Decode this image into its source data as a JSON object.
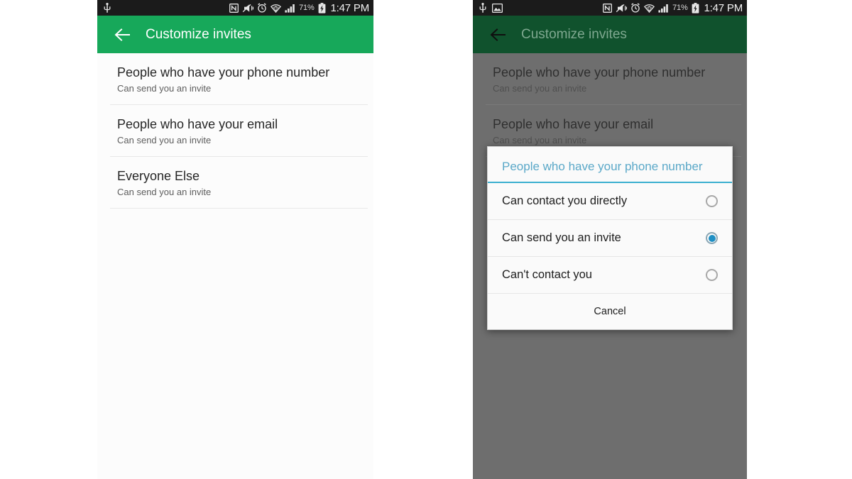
{
  "status_bar": {
    "left_icons_left_phone": [
      "usb-icon"
    ],
    "left_icons_right_phone": [
      "usb-icon",
      "screenshot-image-icon"
    ],
    "right_icons": [
      "nfc-icon",
      "mute-vibrate-icon",
      "alarm-icon",
      "wifi-icon",
      "signal-bars-icon"
    ],
    "battery_percent": "71%",
    "battery_icon": "battery-charging-icon",
    "clock": "1:47 PM"
  },
  "app_bar": {
    "back_icon": "back-arrow-icon",
    "title": "Customize invites"
  },
  "settings_list": [
    {
      "title": "People who have your phone number",
      "subtitle": "Can send you an invite"
    },
    {
      "title": "People who have your email",
      "subtitle": "Can send you an invite"
    },
    {
      "title": "Everyone Else",
      "subtitle": "Can send you an invite"
    }
  ],
  "dialog": {
    "title": "People who have your phone number",
    "options": [
      {
        "label": "Can contact you directly",
        "selected": false
      },
      {
        "label": "Can send you an invite",
        "selected": true
      },
      {
        "label": "Can't contact you",
        "selected": false
      }
    ],
    "cancel_label": "Cancel"
  },
  "colors": {
    "app_bar_green": "#17a85a",
    "app_bar_green_dimmed": "#10522d",
    "scrim": "#6e6e6e",
    "page_background": "#fcfcfc",
    "dialog_title_blue": "#5aa8c8",
    "dialog_accent": "#3aafcf",
    "radio_selected": "#1e8fc4",
    "status_bar": "#1b1b1b"
  }
}
